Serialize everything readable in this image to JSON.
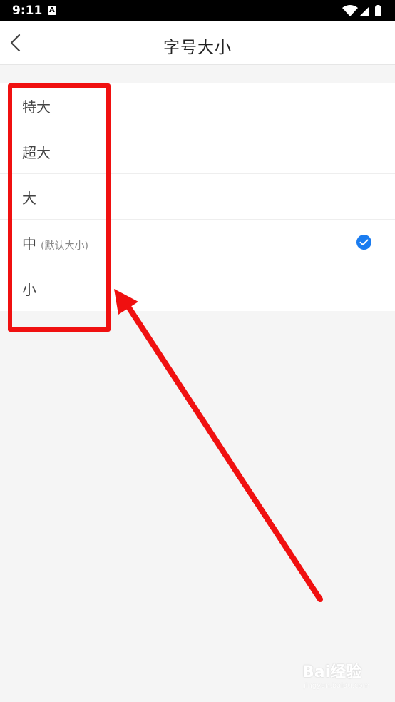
{
  "status_bar": {
    "time": "9:11",
    "notification_glyph": "A"
  },
  "header": {
    "title": "字号大小"
  },
  "options": [
    {
      "label": "特大",
      "note": "",
      "selected": false
    },
    {
      "label": "超大",
      "note": "",
      "selected": false
    },
    {
      "label": "大",
      "note": "",
      "selected": false
    },
    {
      "label": "中",
      "note": "(默认大小)",
      "selected": true
    },
    {
      "label": "小",
      "note": "",
      "selected": false
    }
  ],
  "watermark": {
    "main": "Bai经验",
    "sub": "jingyan.baidu.com"
  },
  "colors": {
    "accent": "#1a7cf0",
    "annotation": "#f01010",
    "background": "#f5f5f5"
  }
}
